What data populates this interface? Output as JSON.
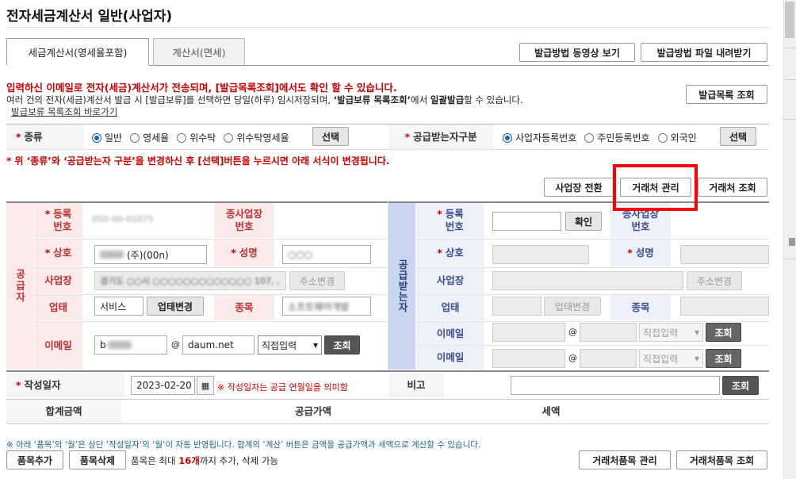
{
  "page_title": "전자세금계산서 일반(사업자)",
  "tabs": [
    {
      "label": "세금계산서(영세율포함)"
    },
    {
      "label": "계산서(면세)"
    }
  ],
  "top_buttons": {
    "video": "발급방법 동영상 보기",
    "file": "발급방법 파일 내려받기"
  },
  "notice": {
    "red": "입력하신 이메일로 전자(세금)계산서가 전송되며, [발급목록조회]에서도 확인 할 수 있습니다.",
    "line2_a": "여러 건의 전자(세금)계산서 발급 시 [발급보류]를 선택하면 당일(하루) 임시저장되며, ",
    "line2_b": "‘발급보류 목록조회’",
    "line2_c": "에서 ",
    "line2_d": "일괄발급",
    "line2_e": "할 수 있습니다.",
    "link": "발급보류 목록조회 바로가기",
    "list_button": "발급목록 조회"
  },
  "kind": {
    "label": "종류",
    "options": [
      "일반",
      "영세율",
      "위수탁",
      "위수탁영세율"
    ],
    "selected": "일반",
    "button": "선택"
  },
  "receiver_type": {
    "label": "공급받는자구분",
    "options": [
      "사업자등록번호",
      "주민등록번호",
      "외국인"
    ],
    "selected": "사업자등록번호",
    "button": "선택"
  },
  "warning": "* 위 ‘종류’와 ‘공급받는자 구분’을 변경하신 후 [선택]버튼을 누르시면 아래 서식이 변경됩니다.",
  "action_buttons": {
    "switch": "사업장 전환",
    "manage": "거래처 관리",
    "lookup": "거래처 조회"
  },
  "supplier": {
    "side_label": "공급자",
    "reg_label": "등록\n번호",
    "reg_value": "050-00-01075",
    "sub_label": "종사업장\n번호",
    "name_label": "상호",
    "name_value": "(주)(00n)",
    "ceo_label": "성명",
    "ceo_value": "○○○",
    "addr_label": "사업장",
    "addr_value": "경기도 ○○시 ○○○○○○○○○○○○○ 107, ,",
    "addr_button": "주소변경",
    "biz_label": "업태",
    "biz_value": "서비스",
    "biz_button": "업태변경",
    "item_label": "종목",
    "item_value": "소프트웨어개발",
    "email_label": "이메일",
    "email_id": "b",
    "email_domain": "daum.net",
    "email_select": "직접입력",
    "email_button": "조회"
  },
  "buyer": {
    "side_label": "공급받는자",
    "reg_label": "등록\n번호",
    "confirm_button": "확인",
    "sub_label": "종사업장\n번호",
    "name_label": "상호",
    "ceo_label": "성명",
    "addr_label": "사업장",
    "addr_button": "주소변경",
    "biz_label": "업태",
    "biz_button": "업태변경",
    "item_label": "종목",
    "email_label": "이메일",
    "email_select": "직접입력",
    "email_button": "조회",
    "email2_label": "이메일",
    "email2_select": "직접입력",
    "email2_button": "조회"
  },
  "write_date": {
    "label": "작성일자",
    "value": "2023-02-20",
    "note": "※ 작성일자는 공급 연월일을 의미함",
    "remark_label": "비고",
    "remark_button": "조회"
  },
  "totals": {
    "total_label": "합계금액",
    "supply_label": "공급가액",
    "tax_label": "세액"
  },
  "bottom_note": "※ 아래 ‘품목’의 ‘월’은 상단 ‘작성일자’의 ‘월’이 자동 반영됩니다. 합계의 ‘계산’ 버튼은 금액을 공급가액과 세액으로 계산할 수 있습니다.",
  "bottom": {
    "add": "품목추가",
    "delete": "품목삭제",
    "limit_a": "품목은 최대 ",
    "limit_b": "16개",
    "limit_c": "까지 추가, 삭제 가능",
    "manage": "거래처품목 관리",
    "lookup": "거래처품목 조회"
  },
  "colors": {
    "accent_red": "#cc0000",
    "highlight": "#ff0000",
    "supplier_bg": "#fbeaea",
    "buyer_bg": "#eef1fa"
  }
}
